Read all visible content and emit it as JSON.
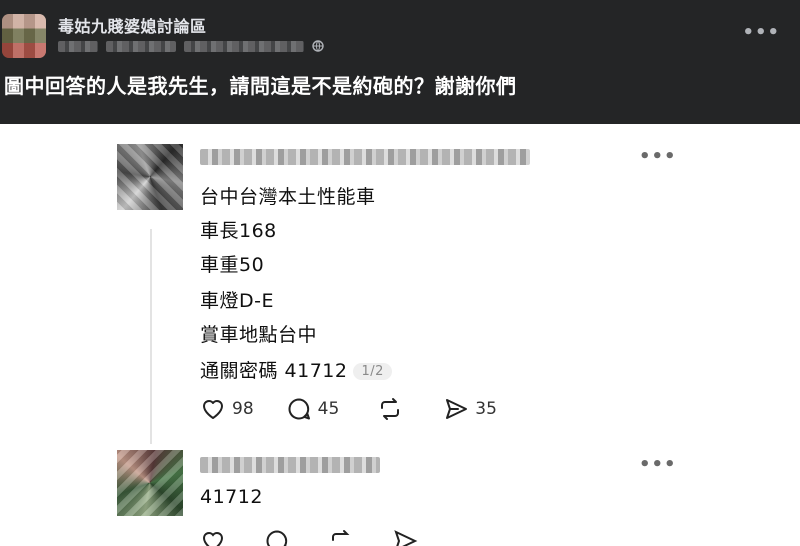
{
  "group": {
    "name": "毒姑九賤婆媳討論區",
    "more_label": "•••"
  },
  "post": {
    "title": "圖中回答的人是我先生，請問這是不是約砲的？謝謝你們"
  },
  "thread": {
    "main_post": {
      "lines": [
        "台中台灣本土性能車",
        "車長168",
        "車重50",
        "車燈D-E",
        "賞車地點台中",
        "通關密碼 41712"
      ],
      "page_indicator": "1/2",
      "likes": "98",
      "comments": "45",
      "reposts": "",
      "shares": "35",
      "more_label": "•••"
    },
    "reply": {
      "text": "41712",
      "more_label": "•••"
    }
  },
  "icons": {
    "like": "heart-icon",
    "comment": "comment-bubble-icon",
    "repost": "repost-arrows-icon",
    "share": "send-paper-plane-icon",
    "privacy": "globe-icon"
  },
  "colors": {
    "header_bg": "#242526",
    "header_text": "#e4e6eb",
    "body_text": "#101010",
    "muted": "#8a8a8a"
  }
}
